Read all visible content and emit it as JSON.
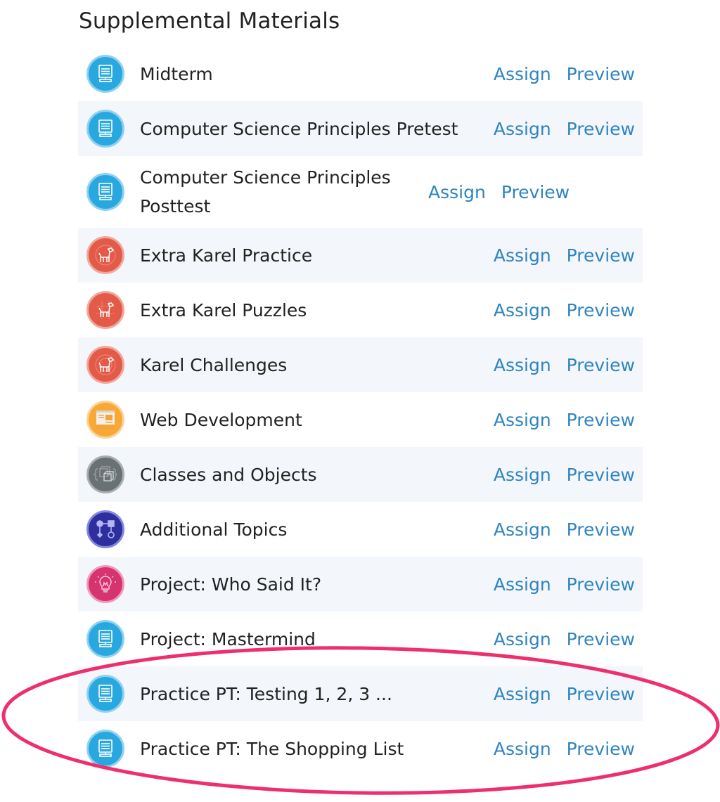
{
  "section": {
    "title": "Supplemental Materials"
  },
  "items": [
    {
      "title": "Midterm",
      "icon": "computer-icon",
      "color": "blue",
      "assign": "Assign",
      "preview": "Preview"
    },
    {
      "title": "Computer Science Principles Pretest",
      "icon": "computer-icon",
      "color": "blue",
      "assign": "Assign",
      "preview": "Preview"
    },
    {
      "title": "Computer Science Principles Posttest",
      "icon": "computer-icon",
      "color": "blue",
      "assign": "Assign",
      "preview": "Preview"
    },
    {
      "title": "Extra Karel Practice",
      "icon": "karel-dog-icon",
      "color": "red",
      "assign": "Assign",
      "preview": "Preview"
    },
    {
      "title": "Extra Karel Puzzles",
      "icon": "karel-dog-icon",
      "color": "red",
      "assign": "Assign",
      "preview": "Preview"
    },
    {
      "title": "Karel Challenges",
      "icon": "karel-dog-icon",
      "color": "red",
      "assign": "Assign",
      "preview": "Preview"
    },
    {
      "title": "Web Development",
      "icon": "webpage-icon",
      "color": "orange",
      "assign": "Assign",
      "preview": "Preview"
    },
    {
      "title": "Classes and Objects",
      "icon": "cubes-braces-icon",
      "color": "gray",
      "assign": "Assign",
      "preview": "Preview"
    },
    {
      "title": "Additional Topics",
      "icon": "flowchart-icon",
      "color": "indigo",
      "assign": "Assign",
      "preview": "Preview"
    },
    {
      "title": "Project: Who Said It?",
      "icon": "lightbulb-icon",
      "color": "pink",
      "assign": "Assign",
      "preview": "Preview"
    },
    {
      "title": "Project: Mastermind",
      "icon": "computer-icon",
      "color": "blue",
      "assign": "Assign",
      "preview": "Preview"
    },
    {
      "title": "Practice PT: Testing 1, 2, 3 ...",
      "icon": "computer-icon",
      "color": "blue",
      "assign": "Assign",
      "preview": "Preview"
    },
    {
      "title": "Practice PT: The Shopping List",
      "icon": "computer-icon",
      "color": "blue",
      "assign": "Assign",
      "preview": "Preview"
    }
  ],
  "colors": {
    "link": "#2f84c0",
    "row_alt_bg": "#f3f6fa",
    "annotation": "#ee2f6e"
  }
}
